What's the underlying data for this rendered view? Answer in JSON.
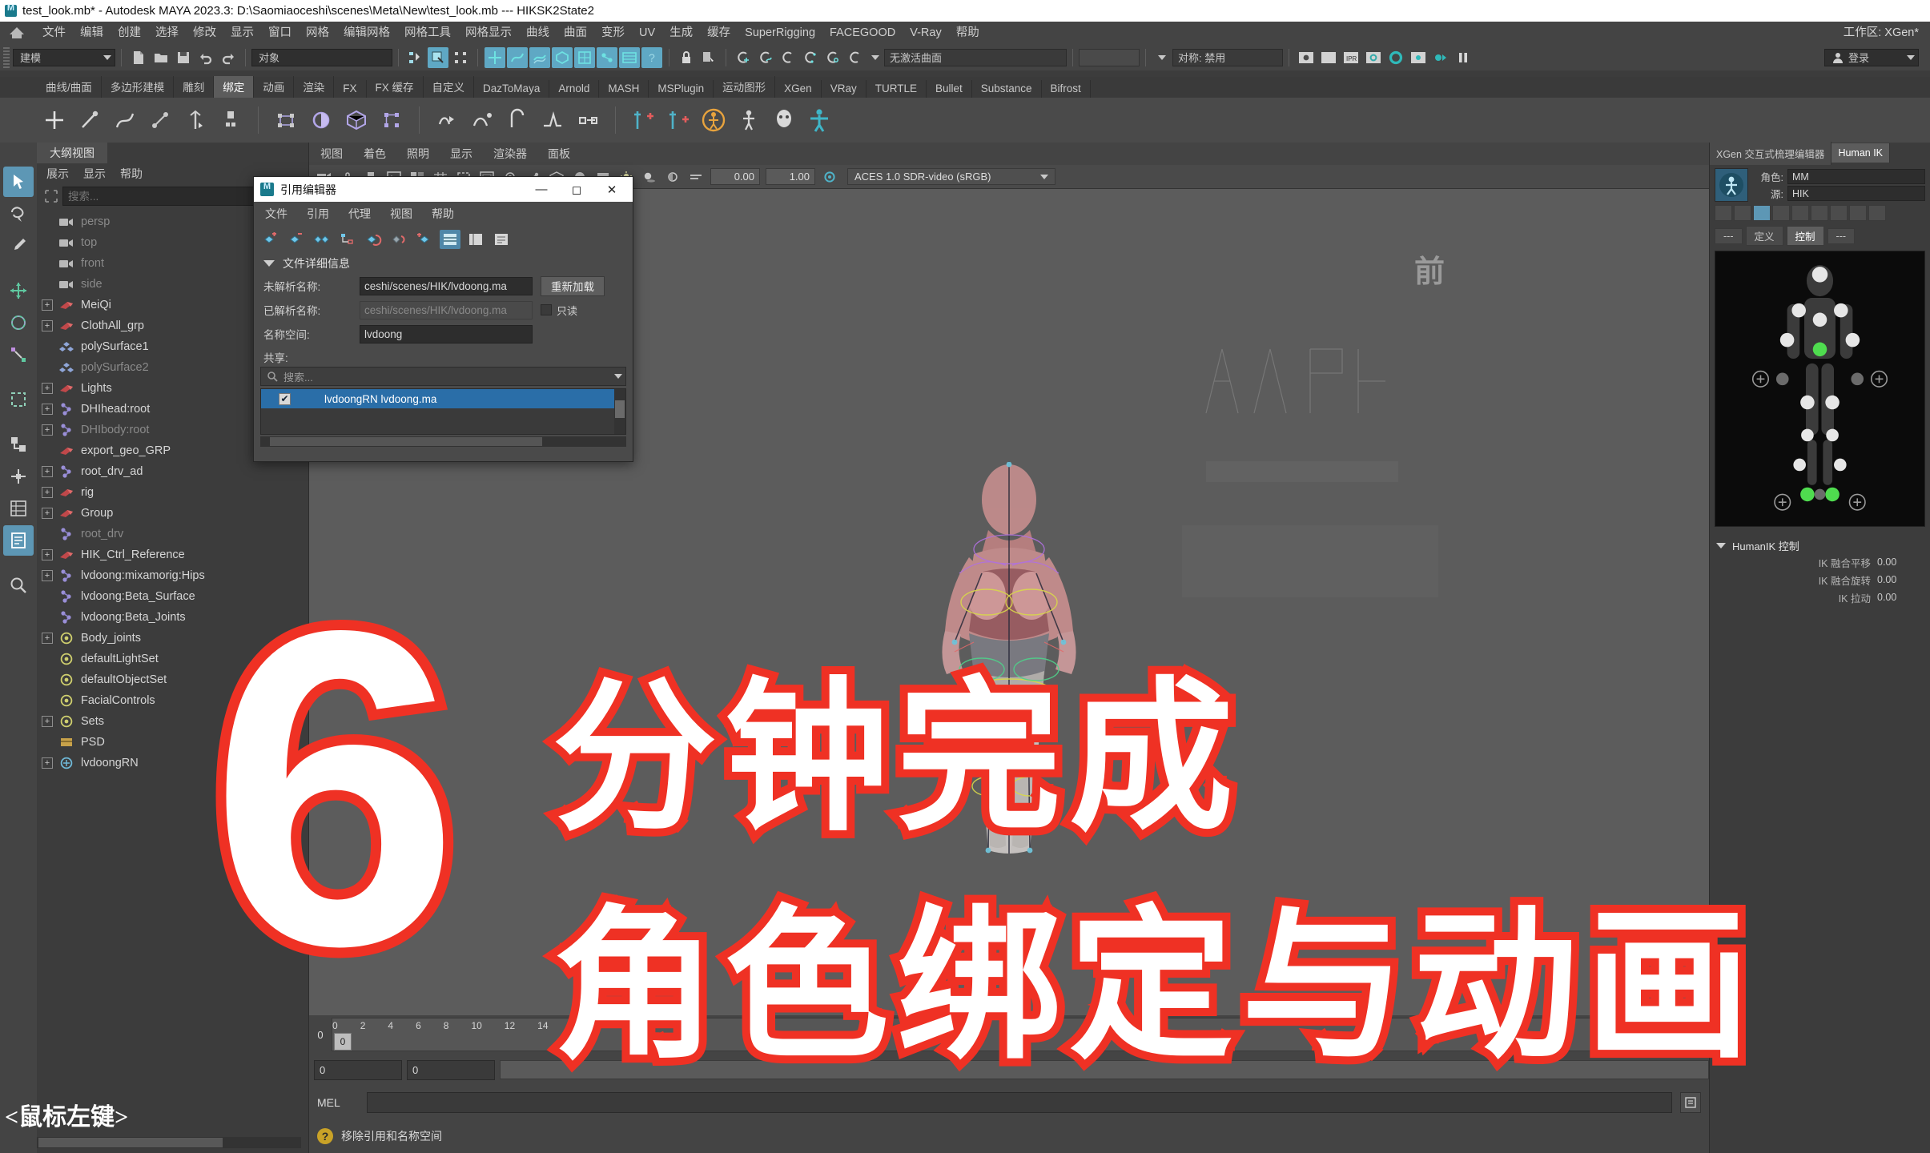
{
  "window": {
    "title": "test_look.mb* - Autodesk MAYA 2023.3: D:\\Saomiaoceshi\\scenes\\Meta\\New\\test_look.mb   ---   HIKSK2State2",
    "logo_icon": "maya-logo-icon"
  },
  "menubar": {
    "home_icon": "home-icon",
    "items": [
      "文件",
      "编辑",
      "创建",
      "选择",
      "修改",
      "显示",
      "窗口",
      "网格",
      "编辑网格",
      "网格工具",
      "网格显示",
      "曲线",
      "曲面",
      "变形",
      "UV",
      "生成",
      "缓存",
      "SuperRigging",
      "FACEGOOD",
      "V-Ray",
      "帮助"
    ],
    "workspace_label": "工作区: XGen*"
  },
  "statusline": {
    "menuset_value": "建模",
    "selection_mask_value": "对象",
    "active_surface_value": "无激活曲面",
    "symmetry_value": "对称: 禁用",
    "login_label": "登录",
    "icons": [
      "new-scene-icon",
      "open-scene-icon",
      "save-scene-icon",
      "undo-icon",
      "redo-icon",
      "select-by-hierarchy-icon",
      "select-by-object-icon",
      "select-by-component-icon",
      "mask-curve-icon",
      "mask-surface-icon",
      "mask-poly-icon",
      "mask-subdiv-icon",
      "mask-deform-icon",
      "mask-dynamic-icon",
      "mask-rendering-icon",
      "mask-misc-icon",
      "lock-icon",
      "highlight-selection-icon",
      "snap-grid-icon",
      "snap-curve-icon",
      "snap-point-icon",
      "snap-projected-icon",
      "snap-view-plane-icon",
      "construction-plane-icon",
      "render-view-icon",
      "render-frame-icon",
      "ipr-render-icon",
      "render-settings-icon",
      "hypershade-icon",
      "render-setup-icon",
      "playblast-icon",
      "pause-icon",
      "user-account-icon"
    ]
  },
  "shelf": {
    "tabs": [
      "曲线/曲面",
      "多边形建模",
      "雕刻",
      "绑定",
      "动画",
      "渲染",
      "FX",
      "FX 缓存",
      "自定义",
      "DazToMaya",
      "Arnold",
      "MASH",
      "MSPlugin",
      "运动图形",
      "XGen",
      "VRay",
      "TURTLE",
      "Bullet",
      "Substance",
      "Bifrost"
    ],
    "active_tab": "绑定",
    "icons": [
      "create-joint-icon",
      "ik-handle-icon",
      "ik-spline-icon",
      "insert-joint-icon",
      "bind-skin-icon",
      "paint-weights-icon",
      "lattice-icon",
      "cluster-icon",
      "wrap-icon",
      "wire-icon",
      "blendshape-icon",
      "sculpt-deformer-icon",
      "nonlinear-bend-icon",
      "soft-mod-icon",
      "curve-warp-icon",
      "create-quick-rig-icon",
      "humanik-icon",
      "skeleton-icon",
      "character-icon",
      "control-rig-icon"
    ]
  },
  "toolbox": {
    "tools": [
      "select-tool",
      "lasso-select-tool",
      "paint-select-tool",
      "move-tool",
      "rotate-tool",
      "scale-tool",
      "last-tool-icon",
      "snap-to-grid-icon",
      "axis-orient-icon",
      "outliner-icon",
      "graph-editor-icon",
      "script-editor-icon",
      "search-icon"
    ]
  },
  "outliner": {
    "tab_label": "大纲视图",
    "menus": [
      "展示",
      "显示",
      "帮助"
    ],
    "search_placeholder": "搜索...",
    "search_icon": "outliner-filter-icon",
    "items": [
      {
        "label": "persp",
        "icon": "camera-icon",
        "expandable": false,
        "dim": true
      },
      {
        "label": "top",
        "icon": "camera-icon",
        "expandable": false,
        "dim": true
      },
      {
        "label": "front",
        "icon": "camera-icon",
        "expandable": false,
        "dim": true
      },
      {
        "label": "side",
        "icon": "camera-icon",
        "expandable": false,
        "dim": true
      },
      {
        "label": "MeiQi",
        "icon": "transform-icon",
        "expandable": true,
        "dim": false
      },
      {
        "label": "ClothAll_grp",
        "icon": "transform-icon",
        "expandable": true,
        "dim": false
      },
      {
        "label": "polySurface1",
        "icon": "mesh-icon",
        "expandable": false,
        "dim": false
      },
      {
        "label": "polySurface2",
        "icon": "mesh-icon",
        "expandable": false,
        "dim": true
      },
      {
        "label": "Lights",
        "icon": "transform-icon",
        "expandable": true,
        "dim": false
      },
      {
        "label": "DHIhead:root",
        "icon": "joint-icon",
        "expandable": true,
        "dim": false
      },
      {
        "label": "DHIbody:root",
        "icon": "joint-icon",
        "expandable": true,
        "dim": true
      },
      {
        "label": "export_geo_GRP",
        "icon": "transform-icon",
        "expandable": false,
        "dim": false
      },
      {
        "label": "root_drv_ad",
        "icon": "joint-icon",
        "expandable": true,
        "dim": false
      },
      {
        "label": "rig",
        "icon": "transform-icon",
        "expandable": true,
        "dim": false
      },
      {
        "label": "Group",
        "icon": "transform-icon",
        "expandable": true,
        "dim": false
      },
      {
        "label": "root_drv",
        "icon": "joint-icon",
        "expandable": false,
        "dim": true
      },
      {
        "label": "HIK_Ctrl_Reference",
        "icon": "transform-icon",
        "expandable": true,
        "dim": false
      },
      {
        "label": "lvdoong:mixamorig:Hips",
        "icon": "joint-icon",
        "expandable": true,
        "dim": false
      },
      {
        "label": "lvdoong:Beta_Surface",
        "icon": "joint-icon",
        "expandable": false,
        "dim": false
      },
      {
        "label": "lvdoong:Beta_Joints",
        "icon": "joint-icon",
        "expandable": false,
        "dim": false
      },
      {
        "label": "Body_joints",
        "icon": "set-icon",
        "expandable": true,
        "dim": false
      },
      {
        "label": "defaultLightSet",
        "icon": "set-icon",
        "expandable": false,
        "dim": false
      },
      {
        "label": "defaultObjectSet",
        "icon": "set-icon",
        "expandable": false,
        "dim": false
      },
      {
        "label": "FacialControls",
        "icon": "set-icon",
        "expandable": false,
        "dim": false
      },
      {
        "label": "Sets",
        "icon": "set-icon",
        "expandable": true,
        "dim": false
      },
      {
        "label": "PSD",
        "icon": "node-icon",
        "expandable": false,
        "dim": false
      },
      {
        "label": "lvdoongRN",
        "icon": "reference-icon",
        "expandable": true,
        "dim": false
      }
    ]
  },
  "viewport": {
    "menus": [
      "视图",
      "着色",
      "照明",
      "显示",
      "渲染器",
      "面板"
    ],
    "axis_label": "前",
    "toolbar_numbers": [
      "0.00",
      "1.00"
    ],
    "colorspace_value": "ACES 1.0 SDR-video (sRGB)",
    "toolbar_icons": [
      "select-camera-icon",
      "lock-camera-icon",
      "bookmark-icon",
      "image-plane-icon",
      "two-pane-icon",
      "grid-toggle-icon",
      "film-gate-icon",
      "resolution-gate-icon",
      "xray-icon",
      "xray-joints-icon",
      "wireframe-icon",
      "smooth-shade-icon",
      "texture-icon",
      "light-icon",
      "shadow-icon",
      "screen-space-ao-icon",
      "motion-blur-icon",
      "multisample-icon",
      "depth-peel-icon",
      "gamma-icon",
      "exposure-icon",
      "color-management-icon"
    ]
  },
  "reference_editor": {
    "title": "引用编辑器",
    "logo_icon": "maya-logo-icon",
    "window_buttons": [
      "minimize-icon",
      "maximize-icon",
      "close-icon"
    ],
    "menus": [
      "文件",
      "引用",
      "代理",
      "视图",
      "帮助"
    ],
    "tools": [
      "add-reference-icon",
      "remove-reference-icon",
      "duplicate-reference-icon",
      "reference-hierarchy-icon",
      "reload-reference-icon",
      "unload-reference-icon",
      "add-proxy-icon",
      "list-view-icon",
      "detail-view-icon",
      "tree-view-icon"
    ],
    "section_label": "文件详细信息",
    "fields": [
      {
        "key": "未解析名称:",
        "value": "ceshi/scenes/HIK/lvdoong.ma",
        "readonly": false
      },
      {
        "key": "已解析名称:",
        "value": "ceshi/scenes/HIK/lvdoong.ma",
        "readonly": true
      },
      {
        "key": "名称空间:",
        "value": "lvdoong",
        "readonly": false
      }
    ],
    "reload_button": "重新加载",
    "readonly_checkbox_label": "只读",
    "share_label": "共享:",
    "search_placeholder": "搜索...",
    "search_icon": "search-icon",
    "list": [
      {
        "checked": true,
        "name": "lvdoongRN  lvdoong.ma"
      }
    ]
  },
  "right_panel": {
    "tabs": [
      "XGen 交互式梳理编辑器",
      "Human IK"
    ],
    "active_tab": "Human IK",
    "character_key": "角色:",
    "character_value": "MM",
    "source_key": "源:",
    "source_value": "HIK",
    "subtabs": [
      "---",
      "定义",
      "控制",
      "---"
    ],
    "active_subtab": "控制",
    "avatar_icon": "humanik-avatar-icon",
    "section_label": "HumanIK 控制",
    "attributes": [
      {
        "key": "IK 融合平移",
        "value": "0.00"
      },
      {
        "key": "IK 融合旋转",
        "value": "0.00"
      },
      {
        "key": "IK 拉动",
        "value": "0.00"
      }
    ]
  },
  "timeline": {
    "start_label": "0",
    "ticks": [
      "0",
      "2",
      "4",
      "6",
      "8",
      "10",
      "12",
      "14"
    ],
    "current_frame": "0",
    "range_start": "0",
    "range_end": "0"
  },
  "command_line": {
    "label": "MEL",
    "input_value": "",
    "execute_icon": "script-editor-icon"
  },
  "help_line": {
    "icon": "help-icon",
    "text": "移除引用和名称空间"
  },
  "bottom_hint": {
    "text": "<鼠标左键>"
  },
  "overlay": {
    "big_number": "6",
    "line1": "分钟完成",
    "line2": "角色绑定与动画",
    "stroke_color": "#ef3124",
    "fill_color": "#ffffff"
  }
}
